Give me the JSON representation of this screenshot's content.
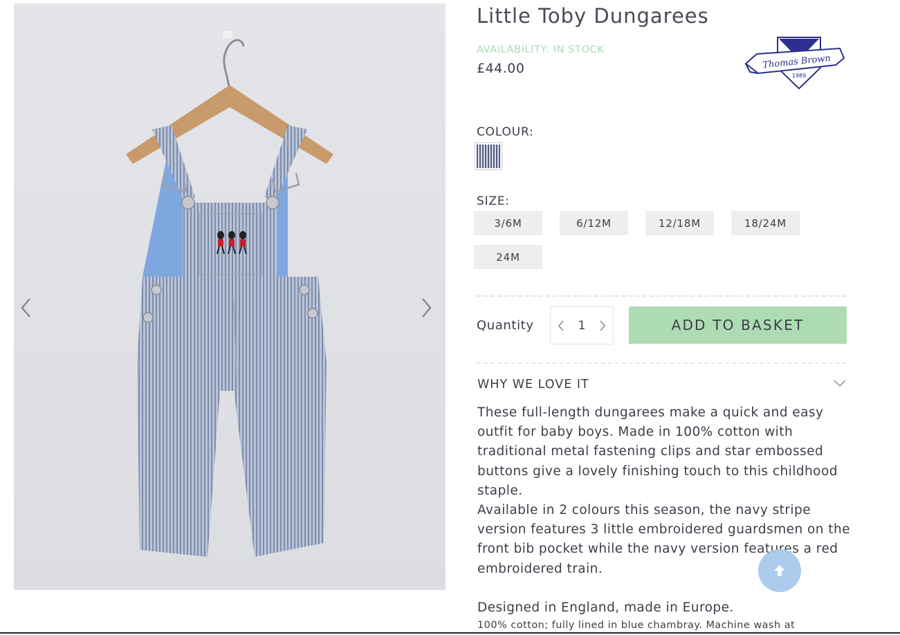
{
  "product": {
    "title": "Little Toby Dungarees",
    "availability": "AVAILABILITY: IN STOCK",
    "price": "£44.00",
    "image_alt": "Little Toby Dungarees - navy stripe with embroidered guardsmen"
  },
  "brand": {
    "name": "Thomas Brown",
    "est": "EST.",
    "year": "1989"
  },
  "colour": {
    "label": "COLOUR:",
    "options": [
      "navy stripe"
    ]
  },
  "size": {
    "label": "SIZE:",
    "options": [
      "3/6M",
      "6/12M",
      "12/18M",
      "18/24M",
      "24M"
    ]
  },
  "quantity": {
    "label": "Quantity",
    "value": "1"
  },
  "basket": {
    "label": "ADD TO BASKET"
  },
  "accordion": {
    "title": "WHY WE LOVE IT",
    "paragraphs": [
      "These full-length dungarees make a quick and easy outfit for baby boys. Made in 100% cotton with traditional metal fastening clips and star embossed buttons give a lovely finishing touch to this childhood staple.",
      "Available in 2 colours this season, the navy stripe version features 3 little embroidered guardsmen on the front bib pocket while the navy version features a red embroidered train.",
      "Designed in England, made in Europe."
    ],
    "care": "100% cotton; fully lined in blue chambray. Machine wash at"
  },
  "colors": {
    "accent_green": "#addcb3",
    "availability_green": "#a9d9b6",
    "back_to_top_blue": "#a9c9ec",
    "text": "#3d3d4a"
  }
}
